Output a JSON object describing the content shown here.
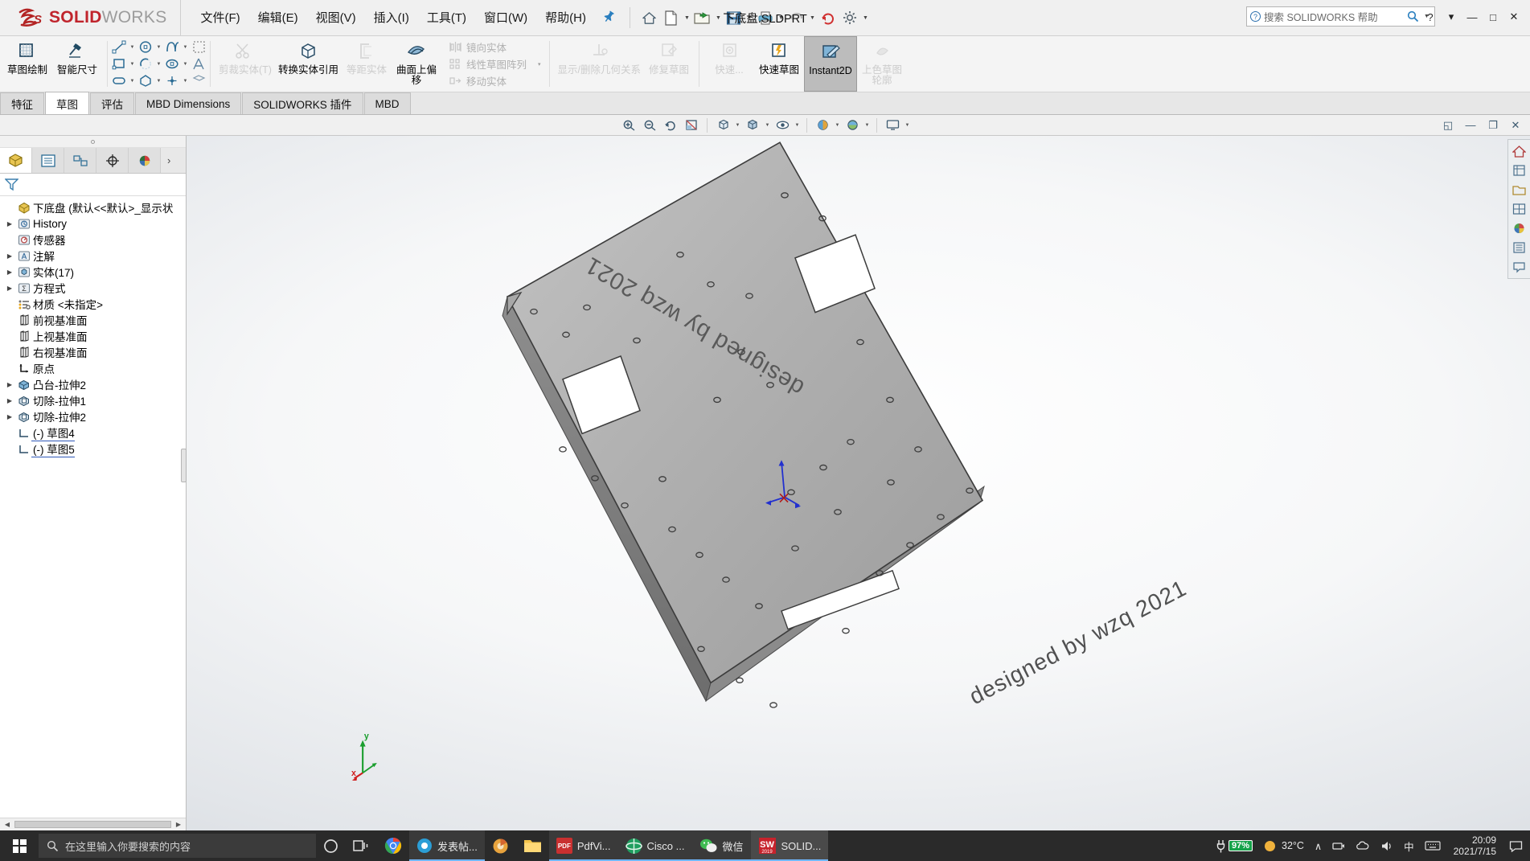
{
  "app": {
    "brand_mark": "3DS",
    "brand_name": "SOLID",
    "brand_name_light": "WORKS",
    "document_title": "下底盘.SLDPRT",
    "accent_color": "#c0242c",
    "selection_color": "#bcbcbc"
  },
  "menubar": {
    "items": [
      {
        "label": "文件(F)"
      },
      {
        "label": "编辑(E)"
      },
      {
        "label": "视图(V)"
      },
      {
        "label": "插入(I)"
      },
      {
        "label": "工具(T)"
      },
      {
        "label": "窗口(W)"
      },
      {
        "label": "帮助(H)"
      }
    ],
    "pin_icon": "pushpin-icon"
  },
  "quick_access": {
    "buttons": [
      {
        "name": "home-icon",
        "glyph": "⌂",
        "has_caret": false
      },
      {
        "name": "new-document-icon",
        "glyph": "",
        "has_caret": true
      },
      {
        "name": "open-folder-icon",
        "glyph": "",
        "has_caret": true
      },
      {
        "name": "save-icon",
        "glyph": "",
        "has_caret": true
      },
      {
        "name": "print-icon",
        "glyph": "",
        "has_caret": true
      },
      {
        "name": "undo-icon",
        "glyph": "↶",
        "has_caret": true
      },
      {
        "name": "rebuild-icon",
        "glyph": "",
        "has_caret": false
      },
      {
        "name": "options-gear-icon",
        "glyph": "",
        "has_caret": true
      }
    ]
  },
  "search": {
    "placeholder": "搜索 SOLIDWORKS 帮助",
    "help_icon": "question-icon",
    "magnifier_icon": "magnifier-icon",
    "caret_icon": "chevron-down-icon"
  },
  "window_controls": {
    "help": "?",
    "caret": "▾",
    "minimize": "—",
    "maximize": "□",
    "close": "✕"
  },
  "ribbon": {
    "groups": [
      {
        "name": "sketch-entities",
        "big_buttons": [
          {
            "label": "草图绘制",
            "icon": "sketch-plane-icon",
            "state": "normal"
          },
          {
            "label": "智能尺寸",
            "icon": "smart-dimension-icon",
            "state": "normal"
          }
        ]
      },
      {
        "name": "sketch-tool-grid",
        "mini_rows": [
          [
            {
              "icon": "line-icon",
              "caret": true
            },
            {
              "icon": "circle-icon",
              "caret": true
            },
            {
              "icon": "spline-icon",
              "caret": true
            },
            {
              "icon": "select-region-icon",
              "caret": false
            }
          ],
          [
            {
              "icon": "rectangle-icon",
              "caret": true
            },
            {
              "icon": "arc-icon",
              "caret": true
            },
            {
              "icon": "ellipse-icon",
              "caret": true
            },
            {
              "icon": "text-icon",
              "caret": false
            }
          ],
          [
            {
              "icon": "slot-icon",
              "caret": true
            },
            {
              "icon": "polygon-icon",
              "caret": false
            },
            {
              "icon": "point-icon",
              "caret": true
            },
            {
              "icon": "plane-icon",
              "caret": false
            }
          ]
        ]
      },
      {
        "name": "modify-entities",
        "big_buttons": [
          {
            "label": "剪裁实体(T)",
            "icon": "trim-entities-icon",
            "state": "disabled"
          },
          {
            "label": "转换实体引用",
            "icon": "convert-entities-icon",
            "state": "normal"
          },
          {
            "label": "等距实体",
            "icon": "offset-entities-icon",
            "state": "disabled"
          },
          {
            "label": "曲面上偏移",
            "icon": "offset-on-surface-icon",
            "state": "normal"
          }
        ]
      },
      {
        "name": "pattern-entities",
        "list_items": [
          {
            "label": "镜向实体",
            "icon": "mirror-entities-icon",
            "state": "disabled"
          },
          {
            "label": "线性草图阵列",
            "icon": "linear-pattern-icon",
            "state": "disabled"
          },
          {
            "label": "移动实体",
            "icon": "move-entities-icon",
            "state": "disabled"
          }
        ],
        "caret": "▾"
      },
      {
        "name": "relations",
        "big_buttons": [
          {
            "label": "显示/删除几何关系",
            "icon": "display-delete-relations-icon",
            "state": "disabled"
          },
          {
            "label": "修复草图",
            "icon": "repair-sketch-icon",
            "state": "disabled"
          }
        ]
      },
      {
        "name": "quick-tools",
        "big_buttons": [
          {
            "label": "快速...",
            "icon": "quick-snaps-icon",
            "state": "disabled"
          },
          {
            "label": "快速草图",
            "icon": "rapid-sketch-icon",
            "state": "normal"
          },
          {
            "label": "Instant2D",
            "icon": "instant2d-icon",
            "state": "active"
          },
          {
            "label": "上色草图轮廓",
            "icon": "shaded-sketch-contour-icon",
            "state": "disabled"
          }
        ]
      }
    ]
  },
  "command_tabs": {
    "tabs": [
      {
        "label": "特征",
        "selected": false
      },
      {
        "label": "草图",
        "selected": true
      },
      {
        "label": "评估",
        "selected": false
      },
      {
        "label": "MBD Dimensions",
        "selected": false
      },
      {
        "label": "SOLIDWORKS 插件",
        "selected": false
      },
      {
        "label": "MBD",
        "selected": false
      }
    ]
  },
  "view_toolbar": {
    "buttons": [
      {
        "name": "zoom-to-fit-icon",
        "glyph": "⊕",
        "caret": false
      },
      {
        "name": "zoom-to-area-icon",
        "glyph": "⊖",
        "caret": false
      },
      {
        "name": "previous-view-icon",
        "glyph": "↺",
        "caret": false
      },
      {
        "name": "section-view-icon",
        "glyph": "◪",
        "caret": false
      },
      {
        "name": "view-orientation-icon",
        "glyph": "▦",
        "caret": true
      },
      {
        "name": "display-style-icon",
        "glyph": "◩",
        "caret": true
      },
      {
        "name": "hide-show-items-icon",
        "glyph": "◉",
        "caret": true
      },
      {
        "name": "edit-appearance-icon",
        "glyph": "◕",
        "caret": true
      },
      {
        "name": "apply-scene-icon",
        "glyph": "◓",
        "caret": true
      },
      {
        "name": "view-settings-icon",
        "glyph": "▭",
        "caret": true
      }
    ],
    "right_buttons": [
      {
        "name": "restore-panes-icon",
        "glyph": "◱"
      },
      {
        "name": "doc-minimize-icon",
        "glyph": "—"
      },
      {
        "name": "doc-restore-icon",
        "glyph": "❐"
      },
      {
        "name": "doc-close-icon",
        "glyph": "✕"
      }
    ]
  },
  "left_panel": {
    "tabs": [
      {
        "name": "feature-manager-tab",
        "icon": "feature-tree-icon",
        "selected": true
      },
      {
        "name": "property-manager-tab",
        "icon": "property-list-icon",
        "selected": false
      },
      {
        "name": "configuration-manager-tab",
        "icon": "configuration-icon",
        "selected": false
      },
      {
        "name": "dimxpert-manager-tab",
        "icon": "dimxpert-icon",
        "selected": false
      },
      {
        "name": "display-manager-tab",
        "icon": "appearance-sphere-icon",
        "selected": false
      }
    ],
    "more_caret": "›",
    "filter_icon": "filter-funnel-icon",
    "tree": [
      {
        "label": "下底盘  (默认<<默认>_显示状",
        "icon": "part-icon",
        "twisty": "none",
        "indent": 0,
        "root": true
      },
      {
        "label": "History",
        "icon": "history-icon",
        "twisty": "collapsed",
        "indent": 1
      },
      {
        "label": "传感器",
        "icon": "sensor-icon",
        "twisty": "none",
        "indent": 1
      },
      {
        "label": "注解",
        "icon": "annotations-icon",
        "twisty": "collapsed",
        "indent": 1
      },
      {
        "label": "实体(17)",
        "icon": "solid-bodies-icon",
        "twisty": "collapsed",
        "indent": 1
      },
      {
        "label": "方程式",
        "icon": "equations-icon",
        "twisty": "collapsed",
        "indent": 1
      },
      {
        "label": "材质 <未指定>",
        "icon": "material-icon",
        "twisty": "none",
        "indent": 1
      },
      {
        "label": "前视基准面",
        "icon": "plane-icon",
        "twisty": "none",
        "indent": 1
      },
      {
        "label": "上视基准面",
        "icon": "plane-icon",
        "twisty": "none",
        "indent": 1
      },
      {
        "label": "右视基准面",
        "icon": "plane-icon",
        "twisty": "none",
        "indent": 1
      },
      {
        "label": "原点",
        "icon": "origin-icon",
        "twisty": "none",
        "indent": 1
      },
      {
        "label": "凸台-拉伸2",
        "icon": "boss-extrude-icon",
        "twisty": "collapsed",
        "indent": 1
      },
      {
        "label": "切除-拉伸1",
        "icon": "cut-extrude-icon",
        "twisty": "collapsed",
        "indent": 1
      },
      {
        "label": "切除-拉伸2",
        "icon": "cut-extrude-icon",
        "twisty": "collapsed",
        "indent": 1
      },
      {
        "label": "(-) 草图4",
        "icon": "sketch-icon",
        "twisty": "none",
        "indent": 1,
        "sketch": true
      },
      {
        "label": "(-) 草图5",
        "icon": "sketch-icon",
        "twisty": "none",
        "indent": 1,
        "sketch": true
      }
    ]
  },
  "graphics": {
    "model_name": "下底盘",
    "engraved_text_top": "designed by wzq 2021",
    "engraved_text_bottom": "designed by wzq 2021",
    "triad_labels": {
      "y": "y",
      "x": "x",
      "z": "z"
    },
    "origin_marker": "origin-triad-icon"
  },
  "taskbar": {
    "search_placeholder": "在这里输入你要搜索的内容",
    "search_icon": "magnifier-icon",
    "items": [
      {
        "name": "cortana-icon",
        "label": "",
        "glyph": "◯"
      },
      {
        "name": "task-view-icon",
        "label": "",
        "glyph": "❏"
      },
      {
        "name": "chrome-icon",
        "label": "",
        "glyph": ""
      },
      {
        "name": "post-app-icon",
        "label": "发表帖...",
        "glyph": ""
      },
      {
        "name": "photos-icon",
        "label": "",
        "glyph": ""
      },
      {
        "name": "file-explorer-icon",
        "label": "",
        "glyph": ""
      },
      {
        "name": "pdf-viewer-icon",
        "label": "PdfVi...",
        "glyph": "PDF"
      },
      {
        "name": "cisco-icon",
        "label": "Cisco ...",
        "glyph": ""
      },
      {
        "name": "wechat-icon",
        "label": "微信",
        "glyph": ""
      },
      {
        "name": "solidworks-taskbar-icon",
        "label": "SOLID...",
        "glyph": "SW"
      }
    ],
    "tray": {
      "battery_percent": "97%",
      "battery_icon": "battery-plug-icon",
      "weather_temp": "32°C",
      "weather_icon": "sun-icon",
      "chevron_up": "∧",
      "network_icon": "network-icon",
      "cloud_icon": "onedrive-icon",
      "volume_icon": "volume-icon",
      "ime_label": "中",
      "keyboard_icon": "keyboard-icon",
      "time": "20:09",
      "date": "2021/7/15",
      "action_center_icon": "action-center-icon"
    }
  }
}
